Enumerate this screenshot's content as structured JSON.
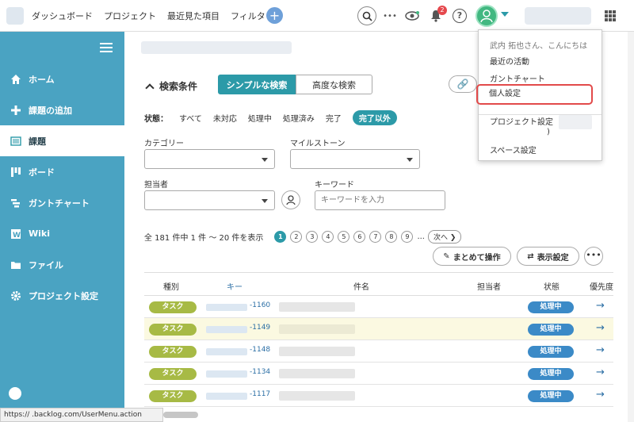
{
  "nav": {
    "items": [
      "ダッシュボード",
      "プロジェクト",
      "最近見た項目",
      "フィルタ"
    ],
    "plus_label": "+",
    "notification_count": "2",
    "help_label": "?",
    "more_label": "•••"
  },
  "sidebar": {
    "items": [
      {
        "label": "ホーム",
        "icon": "home-icon"
      },
      {
        "label": "課題の追加",
        "icon": "plus-icon"
      },
      {
        "label": "課題",
        "icon": "list-icon"
      },
      {
        "label": "ボード",
        "icon": "board-icon"
      },
      {
        "label": "ガントチャート",
        "icon": "gantt-icon"
      },
      {
        "label": "Wiki",
        "icon": "wiki-icon"
      },
      {
        "label": "ファイル",
        "icon": "file-icon"
      },
      {
        "label": "プロジェクト設定",
        "icon": "gear-icon"
      }
    ]
  },
  "search": {
    "title": "検索条件",
    "simple": "シンプルな検索",
    "advanced": "高度な検索",
    "status_label": "状態：",
    "status_options": [
      "すべて",
      "未対応",
      "処理中",
      "処理済み",
      "完了",
      "完了以外"
    ],
    "category_label": "カテゴリー",
    "milestone_label": "マイルストーン",
    "assignee_label": "担当者",
    "keyword_label": "キーワード",
    "keyword_placeholder": "キーワードを入力"
  },
  "pager": {
    "count": "全 181 件中 1 件 〜 20 件を表示",
    "pages": [
      "1",
      "2",
      "3",
      "4",
      "5",
      "6",
      "7",
      "8",
      "9"
    ],
    "ellipsis": "...",
    "next": "次へ ❯"
  },
  "actions": {
    "bulk": "まとめて操作",
    "display": "表示設定",
    "more": "•••"
  },
  "table": {
    "headers": [
      "種別",
      "キー",
      "件名",
      "担当者",
      "状態",
      "優先度"
    ],
    "rows": [
      {
        "type": "タスク",
        "key": "-1160",
        "status": "処理中"
      },
      {
        "type": "タスク",
        "key": "-1149",
        "status": "処理中"
      },
      {
        "type": "タスク",
        "key": "-1148",
        "status": "処理中"
      },
      {
        "type": "タスク",
        "key": "-1134",
        "status": "処理中"
      },
      {
        "type": "タスク",
        "key": "-1117",
        "status": "処理中"
      }
    ]
  },
  "dropdown": {
    "greeting": "武内 拓也さん、こんにちは",
    "items": [
      "最近の活動",
      "ガントチャート",
      "個人設定",
      "プロジェクト設定",
      "スペース設定"
    ],
    "paren": ")"
  },
  "statusbar": {
    "url": "https://       .backlog.com/UserMenu.action"
  },
  "colors": {
    "sidebar": "#4aa3c2",
    "accent": "#2c9aa8",
    "task": "#a7ba45",
    "status_in_progress": "#3b8ac7",
    "highlight": "#e24a4a"
  }
}
